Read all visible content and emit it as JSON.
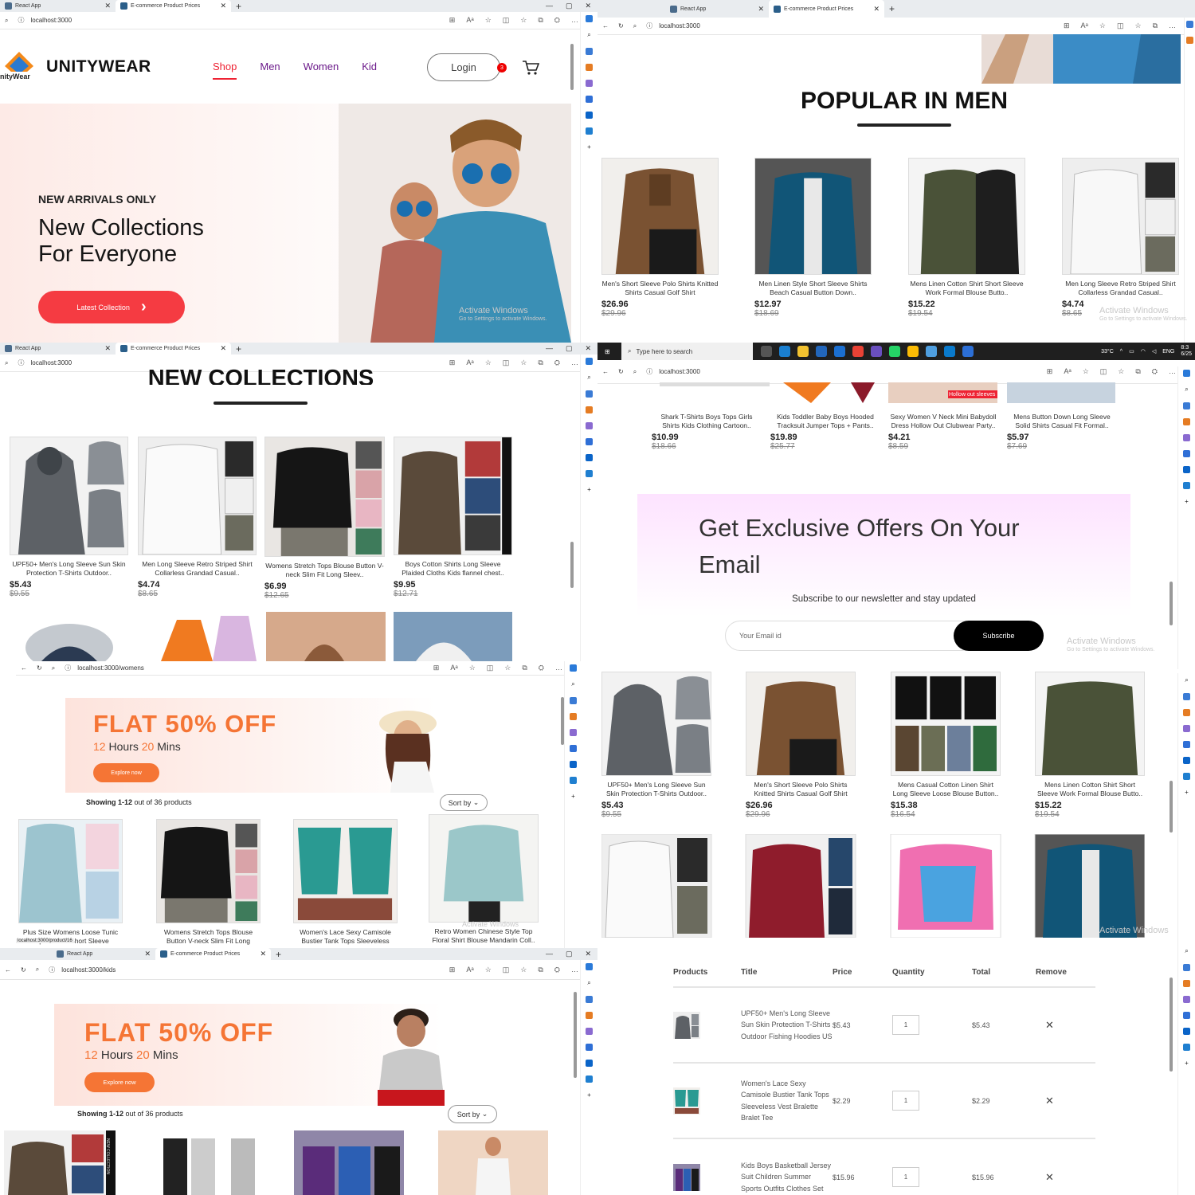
{
  "browser": {
    "tabs": [
      "React App",
      "E-commerce Product Prices"
    ],
    "url_home": "localhost:3000",
    "url_womens": "localhost:3000/womens",
    "url_kids": "localhost:3000/kids",
    "status_url": "localhost:3000/product/16"
  },
  "taskbar": {
    "search_placeholder": "Type here to search",
    "temperature": "33°C",
    "language": "ENG",
    "time": "8:3",
    "date": "6/25"
  },
  "watermark": {
    "title": "Activate Windows",
    "subtitle": "Go to Settings to activate Windows."
  },
  "header": {
    "brand": "UNITYWEAR",
    "logo_text": "nityWear",
    "menu": [
      "Shop",
      "Men",
      "Women",
      "Kid"
    ],
    "login": "Login",
    "cart_count": "3"
  },
  "hero": {
    "tagline": "NEW ARRIVALS ONLY",
    "headline_1": "New Collections",
    "headline_2": "For Everyone",
    "cta": "Latest Collection"
  },
  "popular_men": {
    "title": "POPULAR IN MEN",
    "products": [
      {
        "name": "Men's Short Sleeve Polo Shirts Knitted Shirts Casual Golf Shirt",
        "price": "$26.96",
        "old": "$29.96"
      },
      {
        "name": "Men Linen Style Short Sleeve Shirts Beach Casual Button Down..",
        "price": "$12.97",
        "old": "$18.69"
      },
      {
        "name": "Mens Linen Cotton Shirt Short Sleeve Work Formal Blouse Butto..",
        "price": "$15.22",
        "old": "$19.54"
      },
      {
        "name": "Men Long Sleeve Retro Striped Shirt Collarless Grandad Casual..",
        "price": "$4.74",
        "old": "$8.65"
      }
    ]
  },
  "new_collections": {
    "title": "NEW COLLECTIONS",
    "products": [
      {
        "name": "UPF50+ Men's Long Sleeve Sun Skin Protection T-Shirts Outdoor..",
        "price": "$5.43",
        "old": "$9.55"
      },
      {
        "name": "Men Long Sleeve Retro Striped Shirt Collarless Grandad Casual..",
        "price": "$4.74",
        "old": "$8.65"
      },
      {
        "name": "Womens Stretch Tops Blouse Button V-neck Slim Fit Long Sleev..",
        "price": "$6.99",
        "old": "$12.65"
      },
      {
        "name": "Boys Cotton Shirts Long Sleeve Plaided Cloths Kids flannel chest..",
        "price": "$9.95",
        "old": "$12.71"
      }
    ]
  },
  "related": {
    "products": [
      {
        "name": "Shark T-Shirts Boys Tops Girls Shirts Kids Clothing Cartoon..",
        "price": "$10.99",
        "old": "$18.66"
      },
      {
        "name": "Kids Toddler Baby Boys Hooded Tracksuit Jumper Tops + Pants..",
        "price": "$19.89",
        "old": "$25.77"
      },
      {
        "name": "Sexy Women V Neck Mini Babydoll Dress Hollow Out Clubwear Party..",
        "price": "$4.21",
        "old": "$8.59"
      },
      {
        "name": "Mens Button Down Long Sleeve Solid Shirts Casual Fit Formal..",
        "price": "$5.97",
        "old": "$7.69"
      }
    ],
    "tag_text": "Hollow out sleeves"
  },
  "newsletter": {
    "heading": "Get Exclusive Offers On Your Email",
    "sub": "Subscribe to our newsletter and stay updated",
    "placeholder": "Your Email id",
    "button": "Subscribe"
  },
  "womens": {
    "flat": "FLAT 50% OFF",
    "hours": "12",
    "hours_label": "Hours",
    "mins": "20",
    "mins_label": "Mins",
    "explore": "Explore now",
    "showing_bold": "Showing 1-12",
    "showing_rest": "out of 36 products",
    "sort": "Sort by",
    "products": [
      "Plus Size Womens Loose Tunic Tops Ladies Short Sleeve Summe..",
      "Womens Stretch Tops Blouse Button V-neck Slim Fit Long Sleev..",
      "Women's Lace Sexy Camisole Bustier Tank Tops Sleeveless Ves..",
      "Retro Women Chinese Style Top Floral Shirt Blouse Mandarin Coll.."
    ]
  },
  "mens_grid": {
    "products": [
      {
        "name": "UPF50+ Men's Long Sleeve Sun Skin Protection T-Shirts Outdoor..",
        "price": "$5.43",
        "old": "$9.55"
      },
      {
        "name": "Men's Short Sleeve Polo Shirts Knitted Shirts Casual Golf Shirt",
        "price": "$26.96",
        "old": "$29.96"
      },
      {
        "name": "Mens Casual Cotton Linen Shirt Long Sleeve Loose Blouse Button..",
        "price": "$15.38",
        "old": "$16.54"
      },
      {
        "name": "Mens Linen Cotton Shirt Short Sleeve Work Formal Blouse Butto..",
        "price": "$15.22",
        "old": "$19.54"
      }
    ]
  },
  "kids": {
    "flat": "FLAT 50% OFF",
    "hours": "12",
    "hours_label": "Hours",
    "mins": "20",
    "mins_label": "Mins",
    "explore": "Explore now",
    "showing_bold": "Showing 1-12",
    "showing_rest": "out of 36 products",
    "sort": "Sort by",
    "side_text": "NEW COLLECTION"
  },
  "cart": {
    "headers": [
      "Products",
      "Title",
      "Price",
      "Quantity",
      "Total",
      "Remove"
    ],
    "rows": [
      {
        "title": "UPF50+ Men's Long Sleeve Sun Skin Protection T-Shirts Outdoor Fishing Hoodies US",
        "price": "$5.43",
        "qty": "1",
        "total": "$5.43"
      },
      {
        "title": "Women's Lace Sexy Camisole Bustier Tank Tops Sleeveless Vest Bralette Bralet Tee",
        "price": "$2.29",
        "qty": "1",
        "total": "$2.29"
      },
      {
        "title": "Kids Boys Basketball Jersey Suit Children Summer Sports Outfits Clothes Set",
        "price": "$15.96",
        "qty": "1",
        "total": "$15.96"
      }
    ]
  },
  "colors": {
    "accent_red": "#f53b42",
    "offer_orange": "#f57535",
    "menu_purple": "#6b1a8a"
  }
}
